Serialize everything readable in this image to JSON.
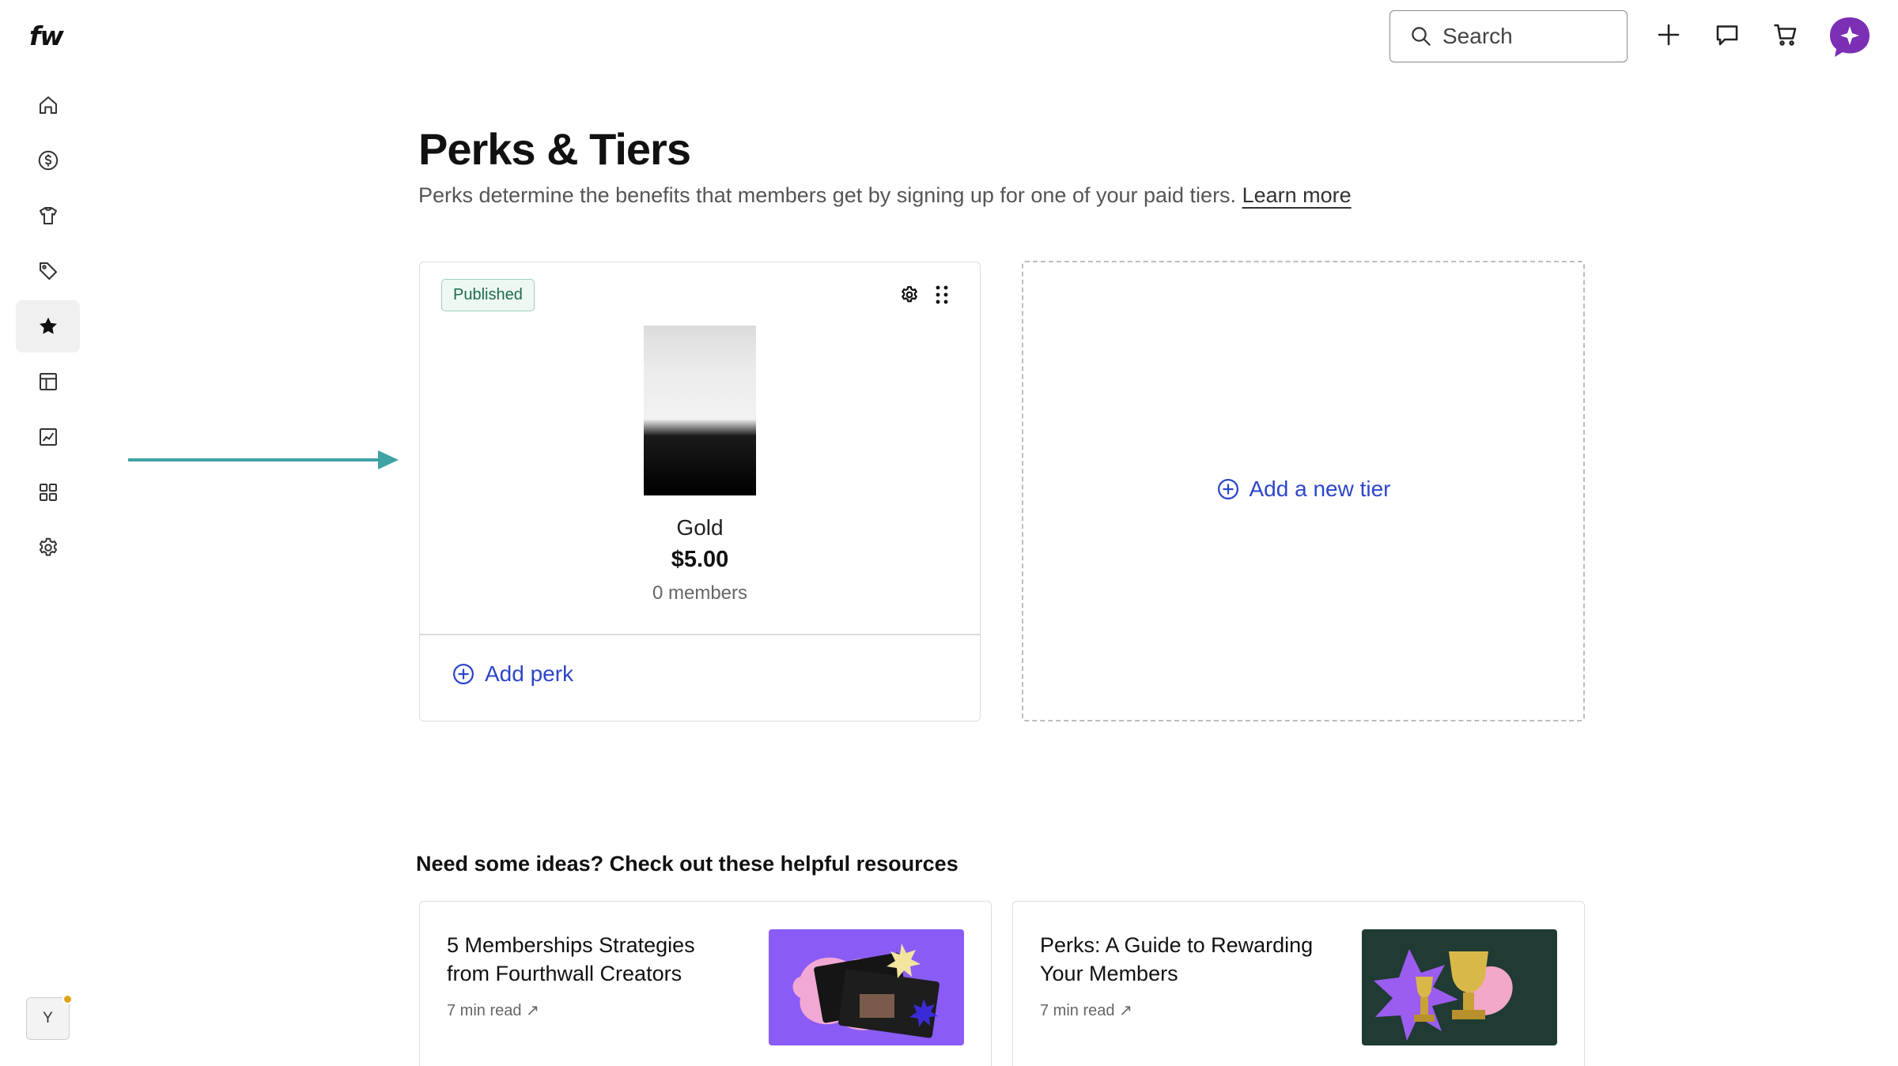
{
  "brand": {
    "logo_text": "fw"
  },
  "sidebar": {
    "items": [
      {
        "name": "home",
        "icon": "home-icon",
        "active": false
      },
      {
        "name": "money",
        "icon": "dollar-icon",
        "active": false
      },
      {
        "name": "products",
        "icon": "shirt-icon",
        "active": false
      },
      {
        "name": "promotions",
        "icon": "tag-icon",
        "active": false
      },
      {
        "name": "memberships",
        "icon": "star-icon",
        "active": true
      },
      {
        "name": "site",
        "icon": "layout-icon",
        "active": false
      },
      {
        "name": "analytics",
        "icon": "chart-icon",
        "active": false
      },
      {
        "name": "apps",
        "icon": "grid-icon",
        "active": false
      },
      {
        "name": "settings",
        "icon": "gear-icon",
        "active": false
      }
    ],
    "user_initial": "Y"
  },
  "topbar": {
    "search_placeholder": "Search"
  },
  "page": {
    "title": "Perks & Tiers",
    "description": "Perks determine the benefits that members get by signing up for one of your paid tiers.",
    "learn_more": "Learn more"
  },
  "tier": {
    "status": "Published",
    "name": "Gold",
    "price": "$5.00",
    "members": "0 members",
    "add_perk": "Add perk"
  },
  "new_tier": {
    "label": "Add a new tier"
  },
  "resources": {
    "title": "Need some ideas? Check out these helpful resources",
    "items": [
      {
        "title": "5 Memberships Strategies from Fourthwall Creators",
        "meta": "7 min read",
        "thumb_bg": "#8a5cf5"
      },
      {
        "title": "Perks: A Guide to Rewarding Your Members",
        "meta": "7 min read",
        "thumb_bg": "#1f3b33"
      }
    ]
  },
  "colors": {
    "accent": "#2d46c9",
    "ai_purple": "#7b2fb4",
    "annotation_arrow": "#3fa3a3"
  }
}
